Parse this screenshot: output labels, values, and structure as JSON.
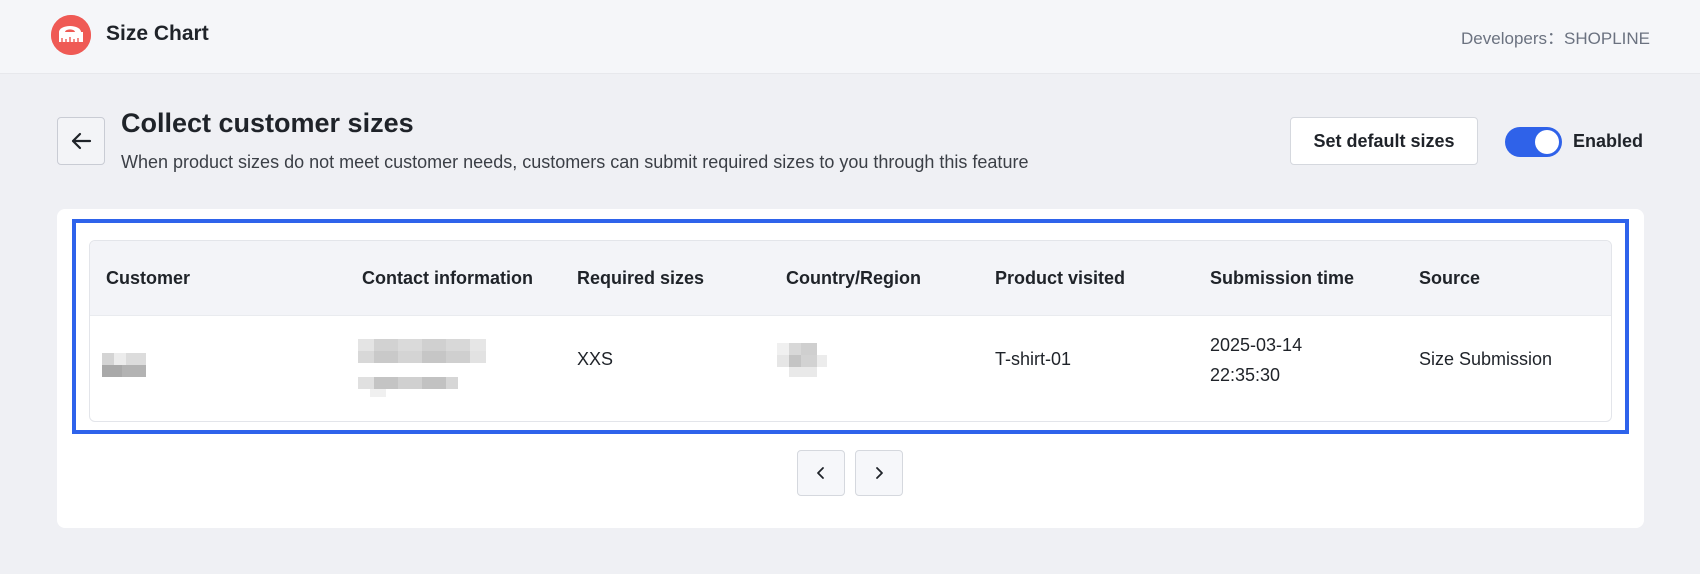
{
  "app": {
    "name": "Size Chart",
    "developer": "Developers：SHOPLINE",
    "accent_color": "#2e63eb",
    "logo_color": "#ef5a55"
  },
  "header": {
    "title": "Collect customer sizes",
    "subtitle": "When product sizes do not meet customer needs, customers can submit required sizes to you through this feature",
    "back_icon": "arrow-left-icon",
    "default_sizes_label": "Set default sizes",
    "toggle": {
      "state": "on",
      "label": "Enabled"
    }
  },
  "table": {
    "columns": [
      "Customer",
      "Contact information",
      "Required sizes",
      "Country/Region",
      "Product visited",
      "Submission time",
      "Source"
    ],
    "rows": [
      {
        "customer": "[redacted]",
        "contact": "[redacted]",
        "required_sizes": "XXS",
        "country": "[redacted]",
        "product": "T-shirt-01",
        "submission_date": "2025-03-14",
        "submission_time": "22:35:30",
        "source": "Size Submission"
      }
    ]
  },
  "pagination": {
    "prev_icon": "chevron-left-icon",
    "next_icon": "chevron-right-icon"
  }
}
